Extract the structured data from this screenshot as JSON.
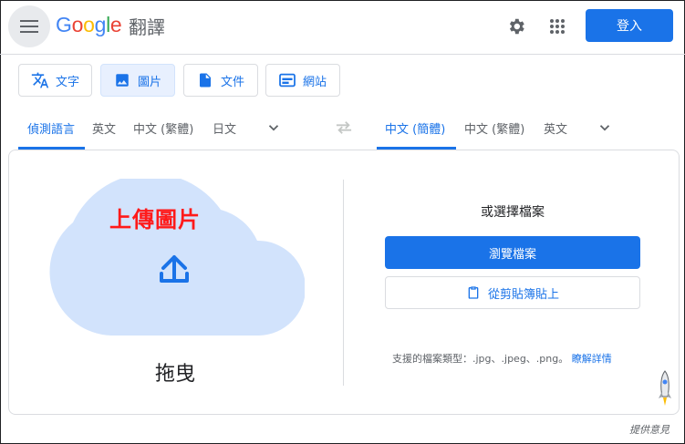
{
  "header": {
    "logo": [
      "G",
      "o",
      "o",
      "g",
      "l",
      "e"
    ],
    "product": "翻譯",
    "signin_label": "登入"
  },
  "modes": [
    {
      "label": "文字",
      "icon": "translate-icon",
      "active": false
    },
    {
      "label": "圖片",
      "icon": "image-icon",
      "active": true
    },
    {
      "label": "文件",
      "icon": "document-icon",
      "active": false
    },
    {
      "label": "網站",
      "icon": "website-icon",
      "active": false
    }
  ],
  "source_langs": [
    "偵測語言",
    "英文",
    "中文 (繁體)",
    "日文"
  ],
  "target_langs": [
    "中文 (簡體)",
    "中文 (繁體)",
    "英文"
  ],
  "upload": {
    "overlay_label": "上傳圖片",
    "drag_label": "拖曳"
  },
  "right": {
    "or_choose": "或選擇檔案",
    "browse_label": "瀏覽檔案",
    "clipboard_label": "從剪貼簿貼上",
    "supported_text": "支援的檔案類型：.jpg、.jpeg、.png。",
    "learn_more": "瞭解詳情"
  },
  "footer": {
    "feedback": "提供意見"
  },
  "colors": {
    "accent": "#1a73e8",
    "cloud": "#d2e3fc",
    "overlay_red": "#ff1a1a"
  }
}
